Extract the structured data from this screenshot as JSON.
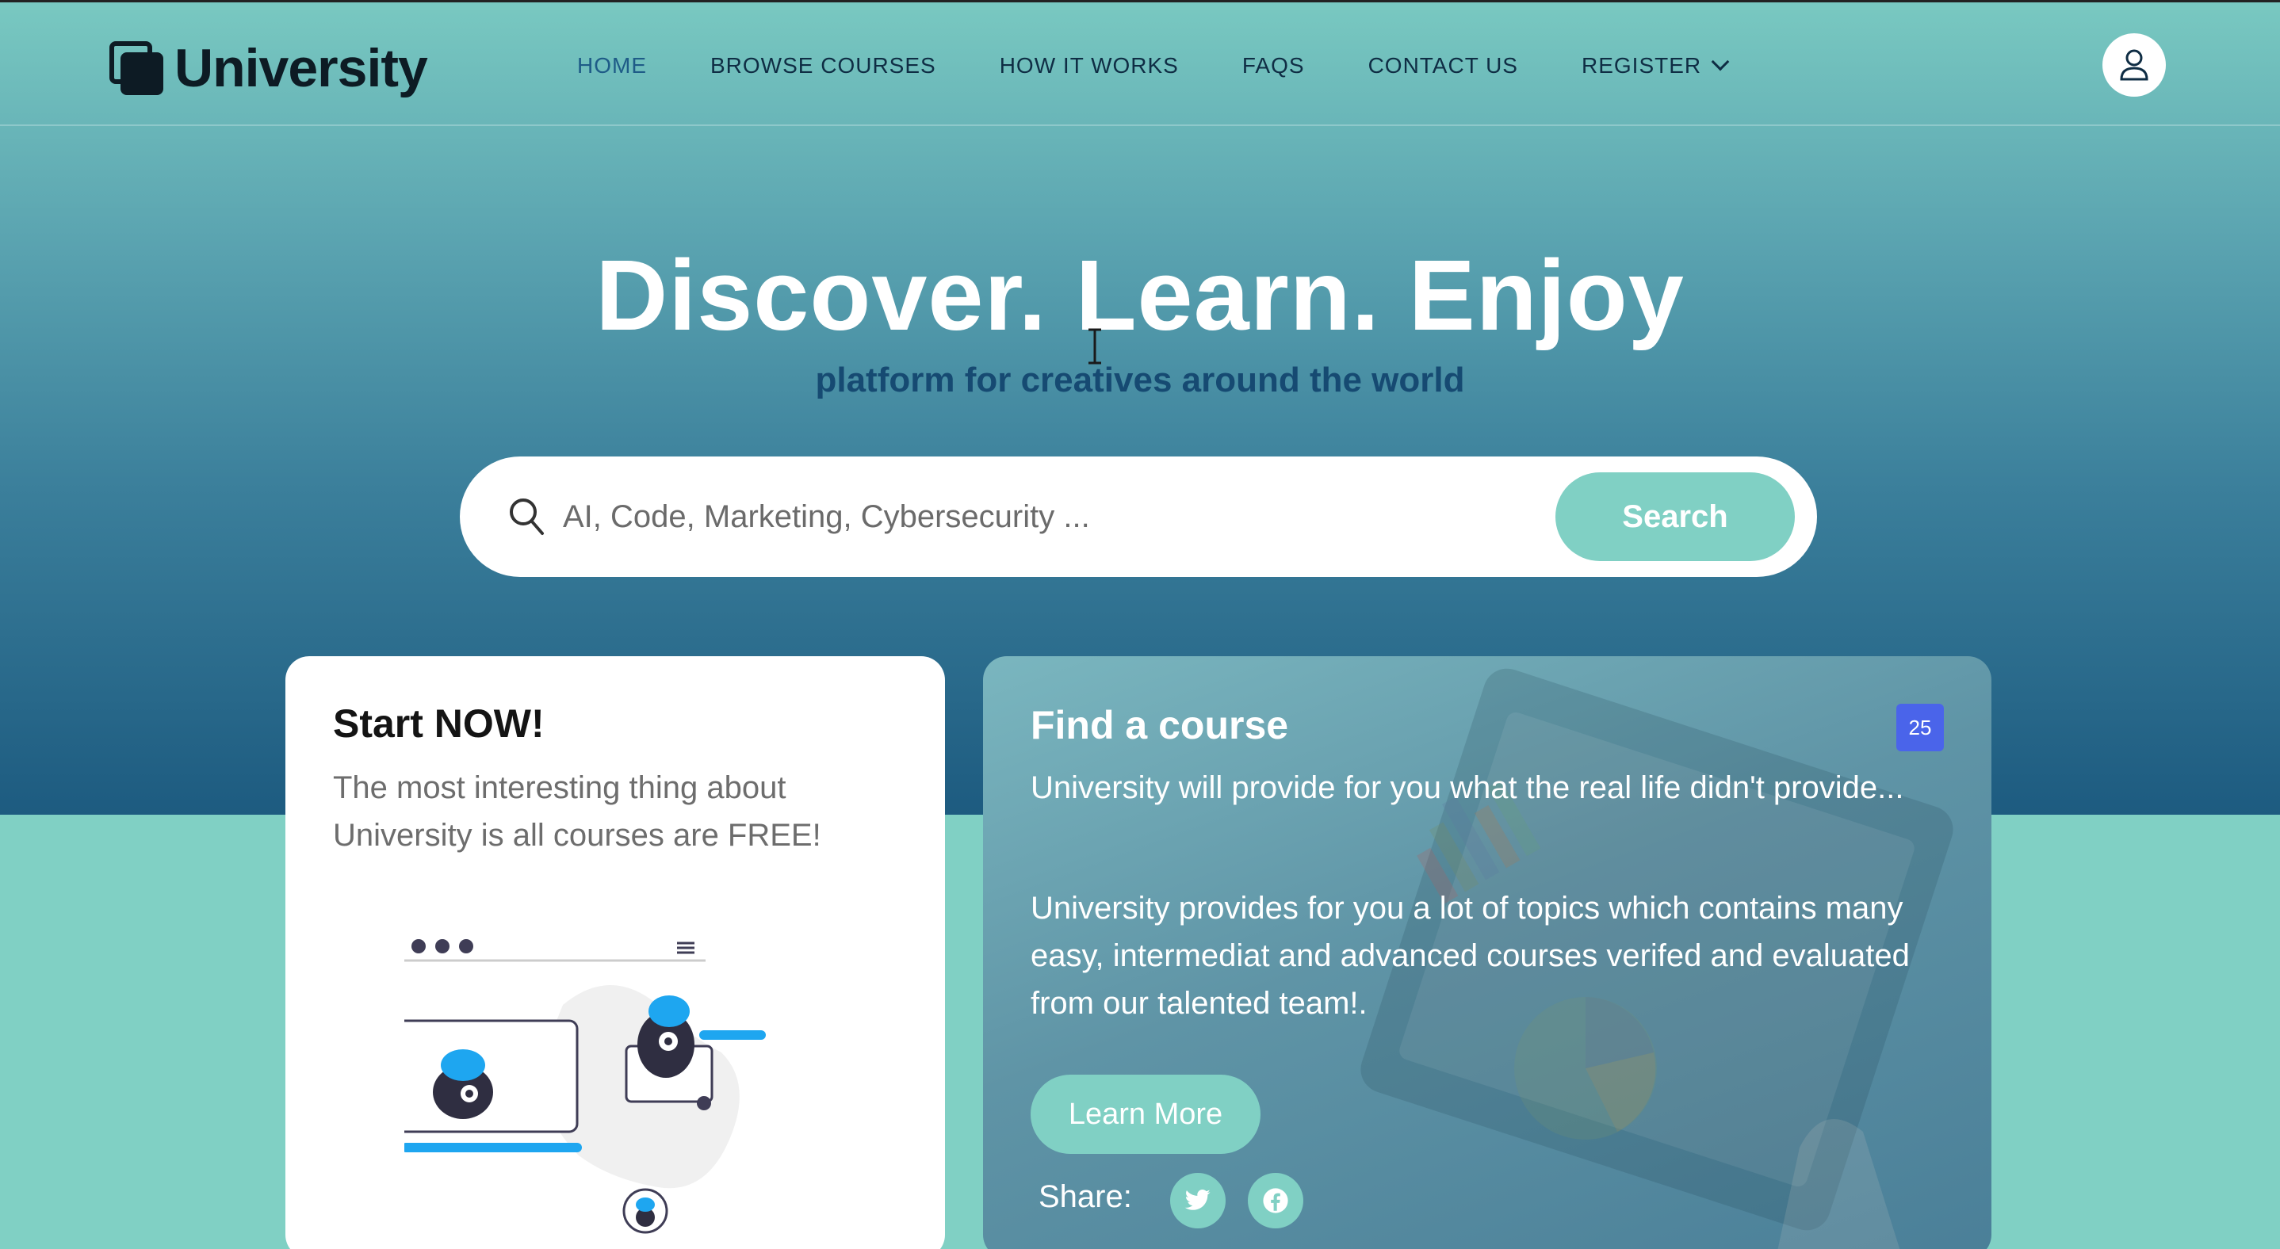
{
  "brand": {
    "name": "University"
  },
  "nav": {
    "items": [
      {
        "label": "HOME",
        "active": true
      },
      {
        "label": "BROWSE COURSES"
      },
      {
        "label": "HOW IT WORKS"
      },
      {
        "label": "FAQS"
      },
      {
        "label": "CONTACT US"
      },
      {
        "label": "REGISTER"
      }
    ]
  },
  "hero": {
    "title": "Discover. Learn. Enjoy",
    "subtitle": "platform for creatives around the world"
  },
  "search": {
    "placeholder": "AI, Code, Marketing, Cybersecurity ...",
    "button_label": "Search"
  },
  "start_card": {
    "title": "Start NOW!",
    "text": "The most interesting thing about University is all courses are FREE!"
  },
  "find_card": {
    "title": "Find a course",
    "badge": "25",
    "paragraph1": "University will provide for you what the real life didn't provide...",
    "paragraph2": "University provides for you a lot of topics which contains many easy, intermediat and advanced courses verifed and evaluated from our talented team!.",
    "learn_more_label": "Learn More",
    "share_label": "Share:"
  },
  "colors": {
    "accent": "#80d0c4",
    "nav_text": "#0f2d44",
    "subtitle": "#164a72",
    "badge": "#4a64ea",
    "illustration_blue": "#1ea6f0"
  },
  "icons": [
    "user-icon",
    "search-icon",
    "chevron-down-icon",
    "twitter-icon",
    "facebook-icon",
    "text-cursor-icon"
  ]
}
